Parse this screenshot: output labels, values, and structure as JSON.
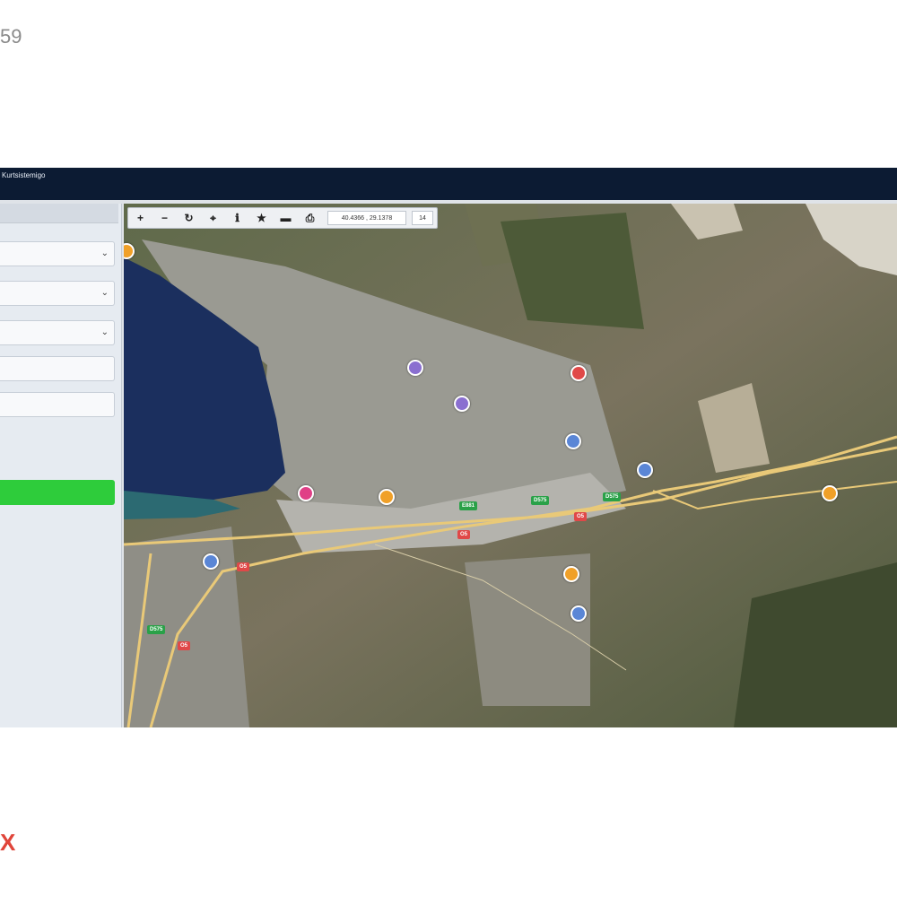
{
  "page": {
    "corner_number": "59",
    "corner_mark": "X"
  },
  "app": {
    "title": "Kurtsistemigo"
  },
  "colors": {
    "header": "#0c1b33",
    "button": "#2ecc3b",
    "sea": "#1b2f5e",
    "road": "#e9c978",
    "poi_purple": "#8a6fd0",
    "poi_red": "#e04848",
    "poi_blue": "#5a86d6",
    "poi_orange": "#f0a028",
    "poi_pink": "#e03f86"
  },
  "map": {
    "coordinates": "40.4366 , 29.1378",
    "zoom": "14",
    "toolbar": [
      {
        "icon": "zoom-in-icon",
        "glyph": "+"
      },
      {
        "icon": "zoom-out-icon",
        "glyph": "−"
      },
      {
        "icon": "refresh-icon",
        "glyph": "↻"
      },
      {
        "icon": "locate-icon",
        "glyph": "⌖"
      },
      {
        "icon": "info-icon",
        "glyph": "ℹ"
      },
      {
        "icon": "star-icon",
        "glyph": "★"
      },
      {
        "icon": "measure-icon",
        "glyph": "▬"
      },
      {
        "icon": "print-icon",
        "glyph": "⎙"
      }
    ],
    "road_shields": [
      {
        "label": "D575",
        "color": "#2aa148"
      },
      {
        "label": "D575",
        "color": "#2aa148"
      },
      {
        "label": "E881",
        "color": "#2aa148"
      },
      {
        "label": "O5",
        "color": "#e04848"
      },
      {
        "label": "O5",
        "color": "#e04848"
      },
      {
        "label": "O5",
        "color": "#e04848"
      },
      {
        "label": "D575",
        "color": "#2aa148"
      },
      {
        "label": "O5",
        "color": "#e04848"
      }
    ]
  }
}
